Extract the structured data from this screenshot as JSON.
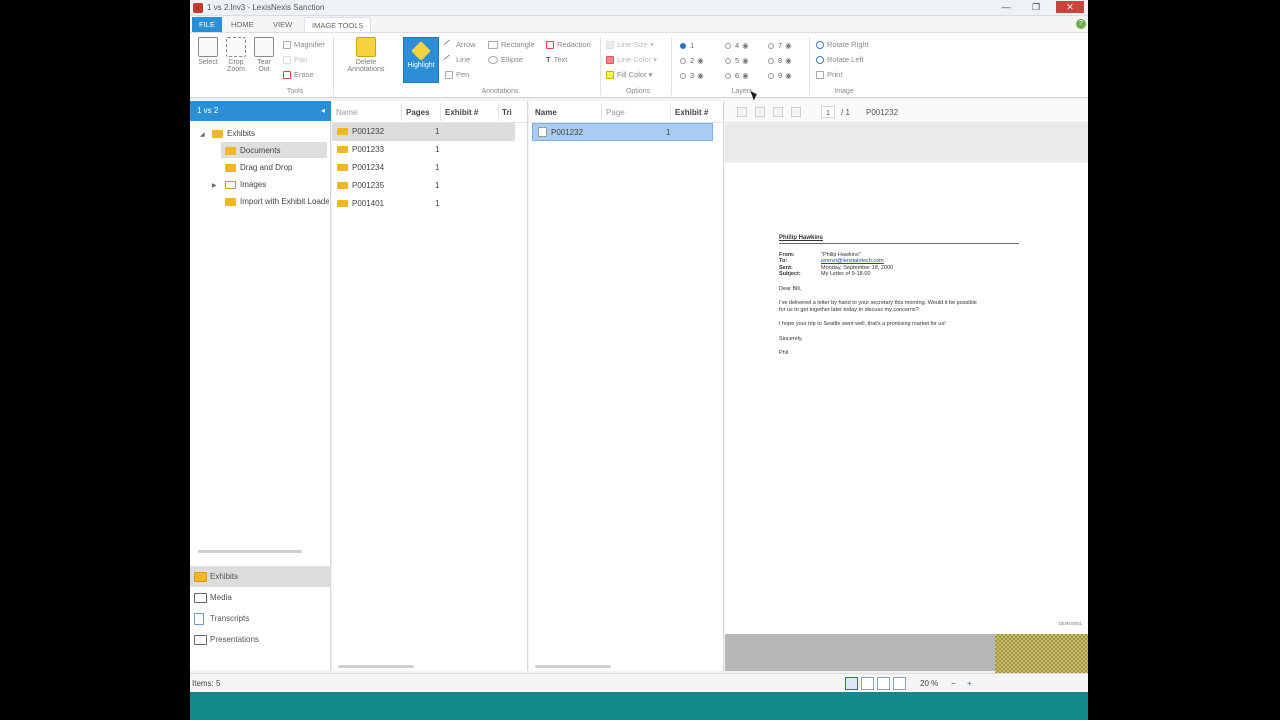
{
  "window": {
    "title": "1 vs 2.lnv3 - LexisNexis Sanction",
    "minimize": "—",
    "restore": "❐",
    "close": "✕"
  },
  "ribbon_tabs": [
    "FILE",
    "HOME",
    "VIEW",
    "IMAGE TOOLS"
  ],
  "ribbon": {
    "tools": {
      "label": "Tools",
      "select": "Select",
      "crop_zoom_1": "Crop",
      "crop_zoom_2": "Zoom",
      "tear_out_1": "Tear",
      "tear_out_2": "Out",
      "magnifier": "Magnifier",
      "pan": "Pan",
      "erase": "Erase"
    },
    "annotations": {
      "label": "Annotations",
      "delete_1": "Delete",
      "delete_2": "Annotations",
      "highlight": "Highlight",
      "arrow": "Arrow",
      "line": "Line",
      "pen": "Pen",
      "rectangle": "Rectangle",
      "ellipse": "Ellipse",
      "redaction": "Redaction",
      "text": "Text"
    },
    "options": {
      "label": "Options",
      "line_size": "Line Size",
      "line_color": "Line Color",
      "fill_color": "Fill Color"
    },
    "layers": {
      "label": "Layers",
      "items": [
        "1",
        "2",
        "3",
        "4",
        "5",
        "6",
        "7",
        "8",
        "9"
      ]
    },
    "image": {
      "label": "Image",
      "rotate_right": "Rotate Right",
      "rotate_left": "Rotate Left",
      "print": "Print"
    }
  },
  "tree": {
    "header": "1 vs 2",
    "items": [
      "Exhibits",
      "Documents",
      "Drag and Drop",
      "Images",
      "Import with Exhibit Loader"
    ]
  },
  "nav": [
    "Exhibits",
    "Media",
    "Transcripts",
    "Presentations"
  ],
  "docgrid": {
    "headers": [
      "Name",
      "Pages",
      "Exhibit #",
      "Tri"
    ],
    "rows": [
      {
        "name": "P001232",
        "pages": "1"
      },
      {
        "name": "P001233",
        "pages": "1"
      },
      {
        "name": "P001234",
        "pages": "1"
      },
      {
        "name": "P001235",
        "pages": "1"
      },
      {
        "name": "P001401",
        "pages": "1"
      }
    ]
  },
  "pagegrid": {
    "headers": [
      "Name",
      "Page",
      "Exhibit #"
    ],
    "rows": [
      {
        "name": "P001232",
        "page": "1"
      }
    ]
  },
  "viewer": {
    "page_num": "1",
    "page_total": "/ 1",
    "doc_name": "P001232",
    "email": {
      "subject_line": "Phillip Hawkins",
      "from_k": "From:",
      "from_v": "\"Philip Hawkins\"",
      "to_k": "To:",
      "to_v": "wrenzi@lenstalotech.com",
      "sent_k": "Sent:",
      "sent_v": "Monday, September 18, 2000",
      "subject_k": "Subject:",
      "subject_v": "My Letter of 9-18-00",
      "salutation": "Dear Bill,",
      "body1": "I've delivered a letter by hand to your secretary this morning.  Would it be possible",
      "body2": "for us to get together later today to discuss my concerns?",
      "body3": "I hope your trip to Seattle went well, that's a promising market for us!",
      "closing": "Sincerely,",
      "signature": "Phil"
    },
    "page_footer": "DEMO0001"
  },
  "status": {
    "items": "Items: 5",
    "zoom": "20 %",
    "zoom_minus": "−",
    "zoom_plus": "+"
  }
}
